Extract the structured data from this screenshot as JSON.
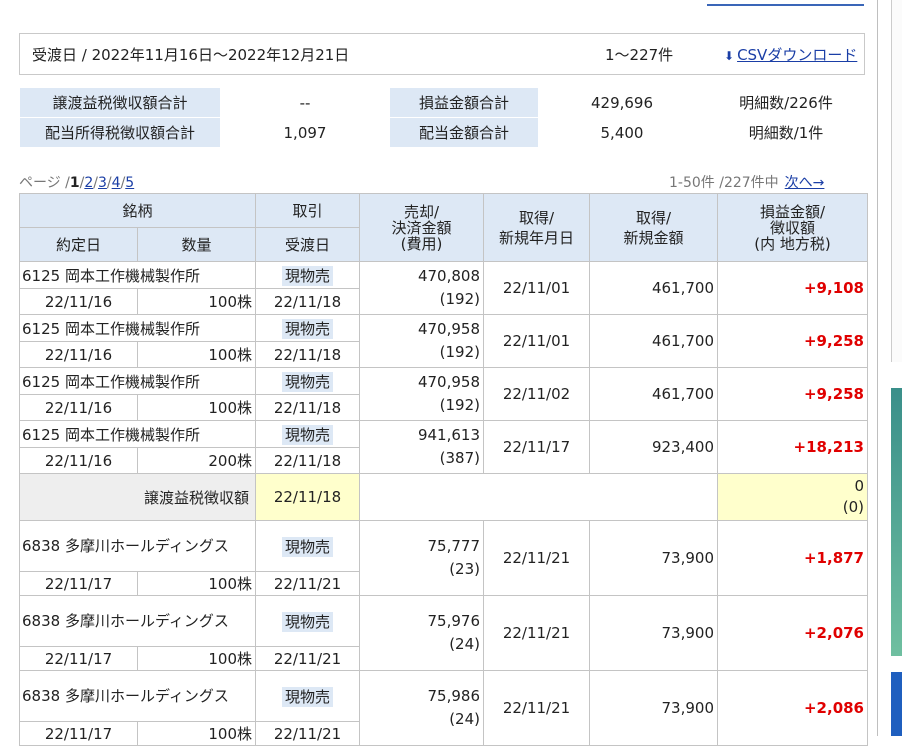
{
  "period": {
    "label": "受渡日 / 2022年11月16日〜2022年12月21日",
    "count": "1〜227件",
    "csv_label": "CSVダウンロード"
  },
  "summary": [
    {
      "label": "譲渡益税徴収額合計",
      "value": "--",
      "label2": "損益金額合計",
      "value2": "429,696",
      "detail": "明細数/226件"
    },
    {
      "label": "配当所得税徴収額合計",
      "value": "1,097",
      "label2": "配当金額合計",
      "value2": "5,400",
      "detail": "明細数/1件"
    }
  ],
  "pager": {
    "prefix": "ページ /",
    "current": "1",
    "pages": [
      "2",
      "3",
      "4",
      "5"
    ],
    "range": "1-50件 /227件中",
    "next": "次へ→"
  },
  "headers": {
    "meigara": "銘柄",
    "torihiki": "取引",
    "baikyaku": "売却/\n決済金額\n(費用)",
    "shutoku_date": "取得/\n新規年月日",
    "shutoku_amount": "取得/\n新規金額",
    "pl": "損益金額/\n徴収額\n(内 地方税)",
    "yakujo": "約定日",
    "suryo": "数量",
    "ukewatashi": "受渡日"
  },
  "rows": [
    {
      "name": "6125 岡本工作機械製作所",
      "trade": "現物売",
      "amount": "470,808",
      "fee": "(192)",
      "acq_date": "22/11/01",
      "acq_amount": "461,700",
      "pl": "+9,108",
      "date": "22/11/16",
      "qty": "100株",
      "settle": "22/11/18"
    },
    {
      "name": "6125 岡本工作機械製作所",
      "trade": "現物売",
      "amount": "470,958",
      "fee": "(192)",
      "acq_date": "22/11/01",
      "acq_amount": "461,700",
      "pl": "+9,258",
      "date": "22/11/16",
      "qty": "100株",
      "settle": "22/11/18"
    },
    {
      "name": "6125 岡本工作機械製作所",
      "trade": "現物売",
      "amount": "470,958",
      "fee": "(192)",
      "acq_date": "22/11/02",
      "acq_amount": "461,700",
      "pl": "+9,258",
      "date": "22/11/16",
      "qty": "100株",
      "settle": "22/11/18"
    },
    {
      "name": "6125 岡本工作機械製作所",
      "trade": "現物売",
      "amount": "941,613",
      "fee": "(387)",
      "acq_date": "22/11/17",
      "acq_amount": "923,400",
      "pl": "+18,213",
      "date": "22/11/16",
      "qty": "200株",
      "settle": "22/11/18"
    }
  ],
  "tax_row": {
    "label": "譲渡益税徴収額",
    "date": "22/11/18",
    "value": "0",
    "sub": "(0)"
  },
  "rows2": [
    {
      "name": "6838 多摩川ホールディングス",
      "trade": "現物売",
      "amount": "75,777",
      "fee": "(23)",
      "acq_date": "22/11/21",
      "acq_amount": "73,900",
      "pl": "+1,877",
      "date": "22/11/17",
      "qty": "100株",
      "settle": "22/11/21"
    },
    {
      "name": "6838 多摩川ホールディングス",
      "trade": "現物売",
      "amount": "75,976",
      "fee": "(24)",
      "acq_date": "22/11/21",
      "acq_amount": "73,900",
      "pl": "+2,076",
      "date": "22/11/17",
      "qty": "100株",
      "settle": "22/11/21"
    },
    {
      "name": "6838 多摩川ホールディングス",
      "trade": "現物売",
      "amount": "75,986",
      "fee": "(24)",
      "acq_date": "22/11/21",
      "acq_amount": "73,900",
      "pl": "+2,086",
      "date": "22/11/17",
      "qty": "100株",
      "settle": "22/11/21"
    }
  ],
  "colors": {
    "accent": "#1a3ea6",
    "header_bg": "#dde8f5",
    "profit": "#e00000",
    "tax_bg": "#ffffcc"
  }
}
